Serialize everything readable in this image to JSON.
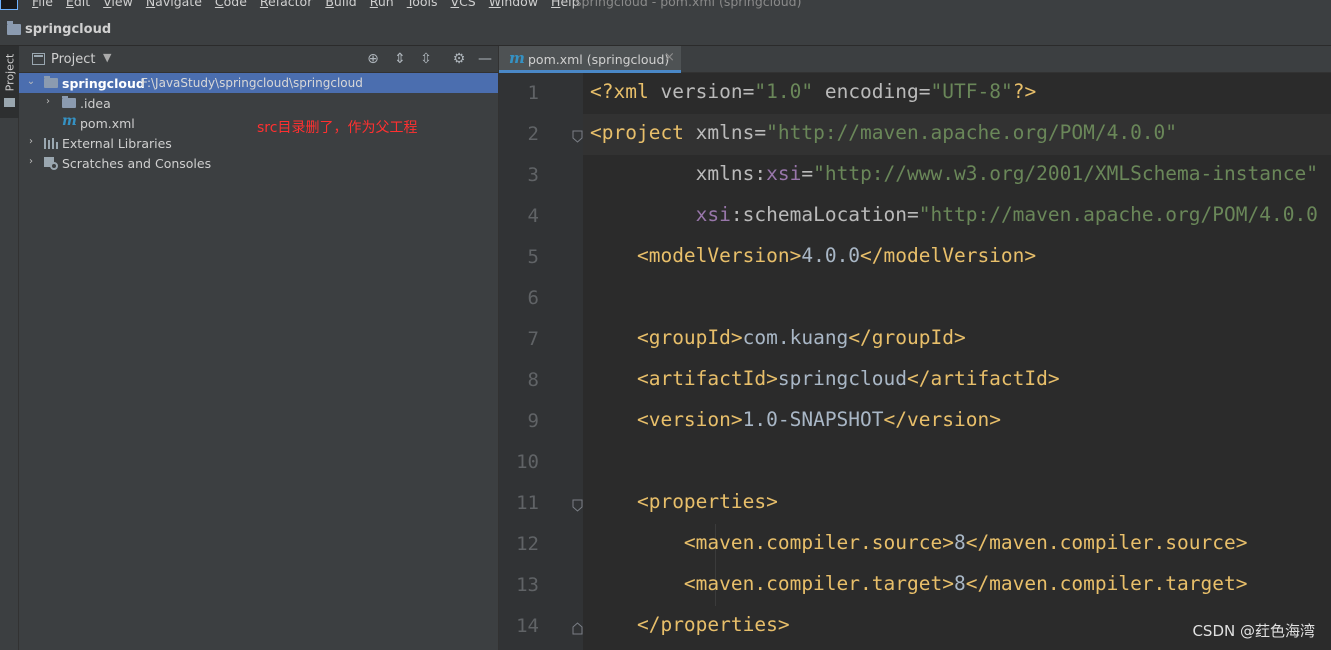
{
  "menubar": {
    "items": [
      "File",
      "Edit",
      "View",
      "Navigate",
      "Code",
      "Refactor",
      "Build",
      "Run",
      "Tools",
      "VCS",
      "Window",
      "Help"
    ],
    "window_title": "springcloud - pom.xml (springcloud)"
  },
  "navbar": {
    "project_name": "springcloud"
  },
  "stripe": {
    "project_tab": "Project"
  },
  "project_panel": {
    "title": "Project",
    "tree": {
      "root_name": "springcloud",
      "root_path": "F:\\JavaStudy\\springcloud\\springcloud",
      "idea": ".idea",
      "pom": "pom.xml",
      "external_libraries": "External Libraries",
      "scratches": "Scratches and Consoles"
    },
    "annotation": "src目录删了，作为父工程"
  },
  "editor": {
    "tab_label": "pom.xml (springcloud)",
    "line_numbers": [
      "1",
      "2",
      "3",
      "4",
      "5",
      "6",
      "7",
      "8",
      "9",
      "10",
      "11",
      "12",
      "13",
      "14"
    ]
  },
  "code": {
    "l1_a": "<?xml ",
    "l1_b": "version",
    "l1_c": "=",
    "l1_d": "\"1.0\"",
    "l1_e": " encoding",
    "l1_f": "=",
    "l1_g": "\"UTF-8\"",
    "l1_h": "?>",
    "l2_tag": "<project ",
    "l2_attr": "xmlns",
    "l2_eq": "=",
    "l2_val": "\"http://maven.apache.org/POM/4.0.0\"",
    "l3_attr": "xmlns:",
    "l3_ns": "xsi",
    "l3_eq": "=",
    "l3_val": "\"http://www.w3.org/2001/XMLSchema-instance\"",
    "l4_ns": "xsi",
    "l4_attr": ":schemaLocation",
    "l4_eq": "=",
    "l4_val": "\"http://maven.apache.org/POM/4.0.0",
    "l5_open": "<modelVersion>",
    "l5_text": "4.0.0",
    "l5_close": "</modelVersion>",
    "l7_open": "<groupId>",
    "l7_text": "com.kuang",
    "l7_close": "</groupId>",
    "l8_open": "<artifactId>",
    "l8_text": "springcloud",
    "l8_close": "</artifactId>",
    "l9_open": "<version>",
    "l9_text": "1.0-SNAPSHOT",
    "l9_close": "</version>",
    "l11": "<properties>",
    "l12_open": "<maven.compiler.source>",
    "l12_text": "8",
    "l12_close": "</maven.compiler.source>",
    "l13_open": "<maven.compiler.target>",
    "l13_text": "8",
    "l13_close": "</maven.compiler.target>",
    "l14": "</properties>"
  },
  "watermark": "CSDN @荭色海湾"
}
